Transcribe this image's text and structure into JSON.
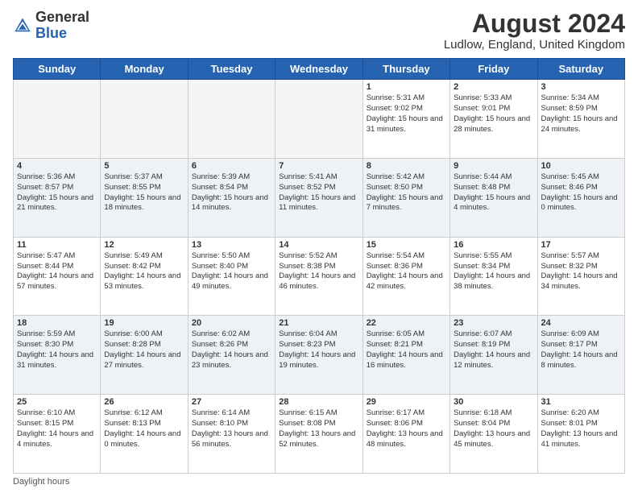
{
  "header": {
    "logo_general": "General",
    "logo_blue": "Blue",
    "month_year": "August 2024",
    "location": "Ludlow, England, United Kingdom"
  },
  "days_of_week": [
    "Sunday",
    "Monday",
    "Tuesday",
    "Wednesday",
    "Thursday",
    "Friday",
    "Saturday"
  ],
  "footer": {
    "daylight_label": "Daylight hours"
  },
  "weeks": [
    [
      {
        "day": "",
        "empty": true
      },
      {
        "day": "",
        "empty": true
      },
      {
        "day": "",
        "empty": true
      },
      {
        "day": "",
        "empty": true
      },
      {
        "day": "1",
        "sunrise": "Sunrise: 5:31 AM",
        "sunset": "Sunset: 9:02 PM",
        "daylight": "Daylight: 15 hours and 31 minutes."
      },
      {
        "day": "2",
        "sunrise": "Sunrise: 5:33 AM",
        "sunset": "Sunset: 9:01 PM",
        "daylight": "Daylight: 15 hours and 28 minutes."
      },
      {
        "day": "3",
        "sunrise": "Sunrise: 5:34 AM",
        "sunset": "Sunset: 8:59 PM",
        "daylight": "Daylight: 15 hours and 24 minutes."
      }
    ],
    [
      {
        "day": "4",
        "sunrise": "Sunrise: 5:36 AM",
        "sunset": "Sunset: 8:57 PM",
        "daylight": "Daylight: 15 hours and 21 minutes."
      },
      {
        "day": "5",
        "sunrise": "Sunrise: 5:37 AM",
        "sunset": "Sunset: 8:55 PM",
        "daylight": "Daylight: 15 hours and 18 minutes."
      },
      {
        "day": "6",
        "sunrise": "Sunrise: 5:39 AM",
        "sunset": "Sunset: 8:54 PM",
        "daylight": "Daylight: 15 hours and 14 minutes."
      },
      {
        "day": "7",
        "sunrise": "Sunrise: 5:41 AM",
        "sunset": "Sunset: 8:52 PM",
        "daylight": "Daylight: 15 hours and 11 minutes."
      },
      {
        "day": "8",
        "sunrise": "Sunrise: 5:42 AM",
        "sunset": "Sunset: 8:50 PM",
        "daylight": "Daylight: 15 hours and 7 minutes."
      },
      {
        "day": "9",
        "sunrise": "Sunrise: 5:44 AM",
        "sunset": "Sunset: 8:48 PM",
        "daylight": "Daylight: 15 hours and 4 minutes."
      },
      {
        "day": "10",
        "sunrise": "Sunrise: 5:45 AM",
        "sunset": "Sunset: 8:46 PM",
        "daylight": "Daylight: 15 hours and 0 minutes."
      }
    ],
    [
      {
        "day": "11",
        "sunrise": "Sunrise: 5:47 AM",
        "sunset": "Sunset: 8:44 PM",
        "daylight": "Daylight: 14 hours and 57 minutes."
      },
      {
        "day": "12",
        "sunrise": "Sunrise: 5:49 AM",
        "sunset": "Sunset: 8:42 PM",
        "daylight": "Daylight: 14 hours and 53 minutes."
      },
      {
        "day": "13",
        "sunrise": "Sunrise: 5:50 AM",
        "sunset": "Sunset: 8:40 PM",
        "daylight": "Daylight: 14 hours and 49 minutes."
      },
      {
        "day": "14",
        "sunrise": "Sunrise: 5:52 AM",
        "sunset": "Sunset: 8:38 PM",
        "daylight": "Daylight: 14 hours and 46 minutes."
      },
      {
        "day": "15",
        "sunrise": "Sunrise: 5:54 AM",
        "sunset": "Sunset: 8:36 PM",
        "daylight": "Daylight: 14 hours and 42 minutes."
      },
      {
        "day": "16",
        "sunrise": "Sunrise: 5:55 AM",
        "sunset": "Sunset: 8:34 PM",
        "daylight": "Daylight: 14 hours and 38 minutes."
      },
      {
        "day": "17",
        "sunrise": "Sunrise: 5:57 AM",
        "sunset": "Sunset: 8:32 PM",
        "daylight": "Daylight: 14 hours and 34 minutes."
      }
    ],
    [
      {
        "day": "18",
        "sunrise": "Sunrise: 5:59 AM",
        "sunset": "Sunset: 8:30 PM",
        "daylight": "Daylight: 14 hours and 31 minutes."
      },
      {
        "day": "19",
        "sunrise": "Sunrise: 6:00 AM",
        "sunset": "Sunset: 8:28 PM",
        "daylight": "Daylight: 14 hours and 27 minutes."
      },
      {
        "day": "20",
        "sunrise": "Sunrise: 6:02 AM",
        "sunset": "Sunset: 8:26 PM",
        "daylight": "Daylight: 14 hours and 23 minutes."
      },
      {
        "day": "21",
        "sunrise": "Sunrise: 6:04 AM",
        "sunset": "Sunset: 8:23 PM",
        "daylight": "Daylight: 14 hours and 19 minutes."
      },
      {
        "day": "22",
        "sunrise": "Sunrise: 6:05 AM",
        "sunset": "Sunset: 8:21 PM",
        "daylight": "Daylight: 14 hours and 16 minutes."
      },
      {
        "day": "23",
        "sunrise": "Sunrise: 6:07 AM",
        "sunset": "Sunset: 8:19 PM",
        "daylight": "Daylight: 14 hours and 12 minutes."
      },
      {
        "day": "24",
        "sunrise": "Sunrise: 6:09 AM",
        "sunset": "Sunset: 8:17 PM",
        "daylight": "Daylight: 14 hours and 8 minutes."
      }
    ],
    [
      {
        "day": "25",
        "sunrise": "Sunrise: 6:10 AM",
        "sunset": "Sunset: 8:15 PM",
        "daylight": "Daylight: 14 hours and 4 minutes."
      },
      {
        "day": "26",
        "sunrise": "Sunrise: 6:12 AM",
        "sunset": "Sunset: 8:13 PM",
        "daylight": "Daylight: 14 hours and 0 minutes."
      },
      {
        "day": "27",
        "sunrise": "Sunrise: 6:14 AM",
        "sunset": "Sunset: 8:10 PM",
        "daylight": "Daylight: 13 hours and 56 minutes."
      },
      {
        "day": "28",
        "sunrise": "Sunrise: 6:15 AM",
        "sunset": "Sunset: 8:08 PM",
        "daylight": "Daylight: 13 hours and 52 minutes."
      },
      {
        "day": "29",
        "sunrise": "Sunrise: 6:17 AM",
        "sunset": "Sunset: 8:06 PM",
        "daylight": "Daylight: 13 hours and 48 minutes."
      },
      {
        "day": "30",
        "sunrise": "Sunrise: 6:18 AM",
        "sunset": "Sunset: 8:04 PM",
        "daylight": "Daylight: 13 hours and 45 minutes."
      },
      {
        "day": "31",
        "sunrise": "Sunrise: 6:20 AM",
        "sunset": "Sunset: 8:01 PM",
        "daylight": "Daylight: 13 hours and 41 minutes."
      }
    ]
  ]
}
